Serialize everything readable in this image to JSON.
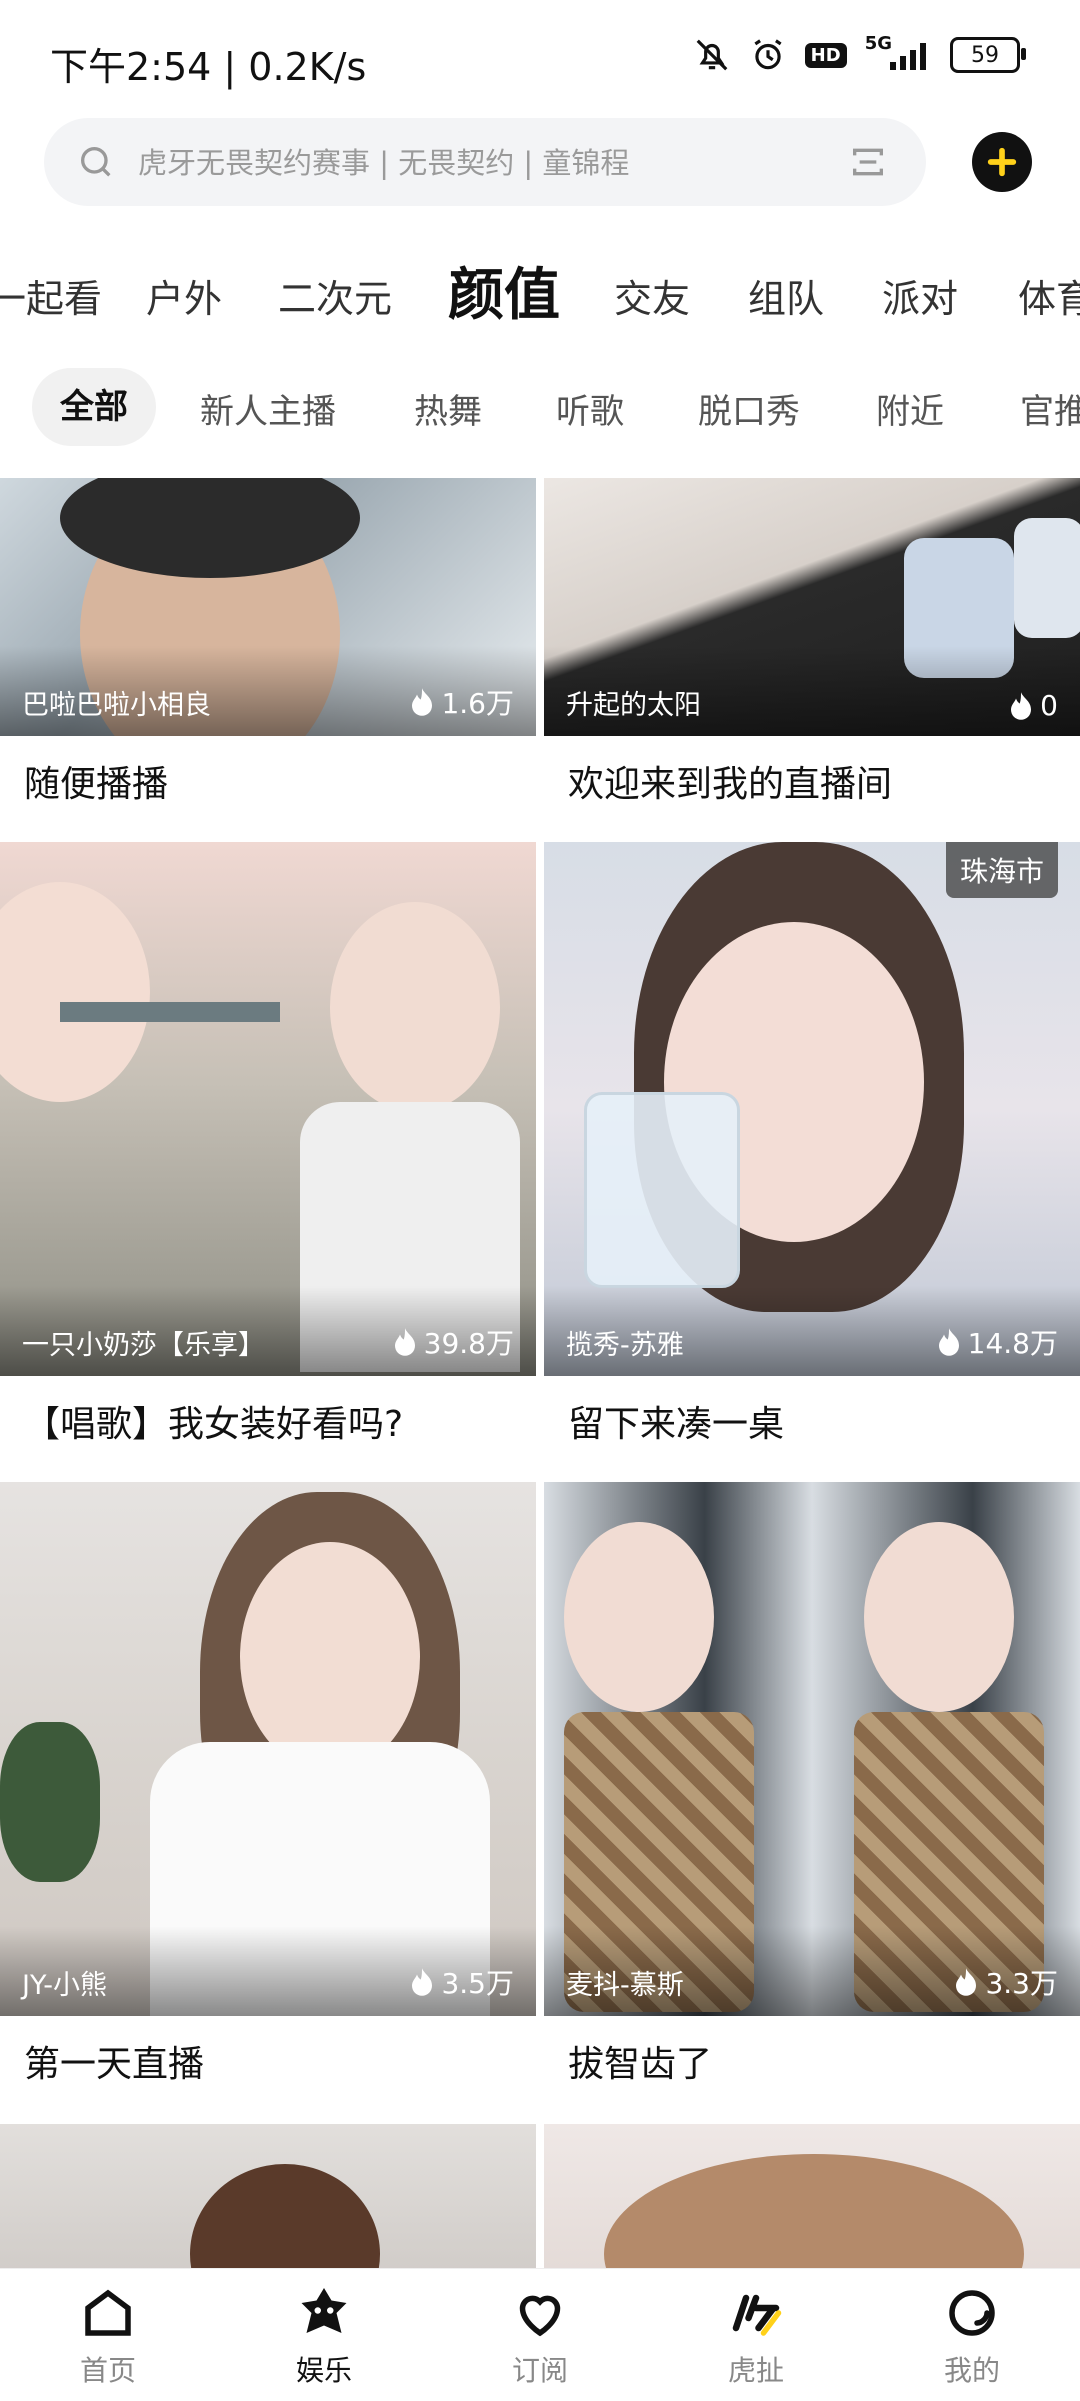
{
  "status_bar": {
    "time": "下午2:54 | 0.2K/s",
    "hd": "HD",
    "network": "5G",
    "battery": "59"
  },
  "search": {
    "placeholder": "虎牙无畏契约赛事 | 无畏契约 | 童锦程"
  },
  "category_tabs": [
    {
      "label": "一起看"
    },
    {
      "label": "户外"
    },
    {
      "label": "二次元"
    },
    {
      "label": "颜值",
      "active": true
    },
    {
      "label": "交友"
    },
    {
      "label": "组队"
    },
    {
      "label": "派对"
    },
    {
      "label": "体育"
    }
  ],
  "sub_tabs": [
    {
      "label": "全部",
      "active": true
    },
    {
      "label": "新人主播"
    },
    {
      "label": "热舞"
    },
    {
      "label": "听歌"
    },
    {
      "label": "脱口秀"
    },
    {
      "label": "附近"
    },
    {
      "label": "官推"
    }
  ],
  "cards": [
    {
      "streamer": "巴啦巴啦小相良",
      "viewers": "1.6万",
      "title": "随便播播",
      "location": ""
    },
    {
      "streamer": "升起的太阳",
      "viewers": "0",
      "title": "欢迎来到我的直播间",
      "location": ""
    },
    {
      "streamer": "一只小奶莎【乐享】",
      "viewers": "39.8万",
      "title": "【唱歌】我女装好看吗?",
      "location": ""
    },
    {
      "streamer": "揽秀-苏雅",
      "viewers": "14.8万",
      "title": "留下来凑一桌",
      "location": "珠海市"
    },
    {
      "streamer": "JY-小熊",
      "viewers": "3.5万",
      "title": "第一天直播",
      "location": ""
    },
    {
      "streamer": "麦抖-慕斯",
      "viewers": "3.3万",
      "title": "拔智齿了",
      "location": ""
    }
  ],
  "bottom_nav": [
    {
      "label": "首页",
      "icon": "home-icon"
    },
    {
      "label": "娱乐",
      "icon": "entertainment-icon",
      "active": true
    },
    {
      "label": "订阅",
      "icon": "heart-icon"
    },
    {
      "label": "虎扯",
      "icon": "huche-icon"
    },
    {
      "label": "我的",
      "icon": "profile-icon"
    }
  ],
  "colors": {
    "accent": "#ffd11a",
    "text_primary": "#111111",
    "text_secondary": "#888888",
    "search_bg": "#f3f4f6"
  }
}
